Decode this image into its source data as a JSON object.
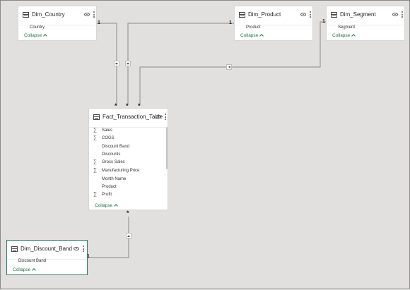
{
  "tables": {
    "dim_country": {
      "title": "Dim_Country",
      "fields": [
        "Country"
      ],
      "collapse": "Collapse"
    },
    "dim_product": {
      "title": "Dim_Product",
      "fields": [
        "Product"
      ],
      "collapse": "Collapse"
    },
    "dim_segment": {
      "title": "Dim_Segment",
      "fields": [
        "Segment"
      ],
      "collapse": "Collapse"
    },
    "fact": {
      "title": "Fact_Transaction_Table",
      "fields": [
        {
          "name": "Sales",
          "sigma": "∑"
        },
        {
          "name": "COGS",
          "sigma": "∑"
        },
        {
          "name": "Discount Band",
          "sigma": ""
        },
        {
          "name": "Discounts",
          "sigma": ""
        },
        {
          "name": "Gross Sales",
          "sigma": "∑"
        },
        {
          "name": "Manufacturing Price",
          "sigma": "∑"
        },
        {
          "name": "Month Name",
          "sigma": ""
        },
        {
          "name": "Product",
          "sigma": ""
        },
        {
          "name": "Profit",
          "sigma": "∑"
        }
      ],
      "collapse": "Collapse"
    },
    "dim_discount_band": {
      "title": "Dim_Discount_Band",
      "fields": [
        "Discount Band"
      ],
      "collapse": "Collapse"
    }
  },
  "cardinality": {
    "one": "1",
    "many": "*"
  },
  "icons": {
    "table": "table-icon",
    "visibility": "eye-icon",
    "more": "more-options-icon",
    "filter_direction": "triangle-icon"
  },
  "colors": {
    "canvas": "#e2e0de",
    "accent": "#217346",
    "selected_border": "#2e7d6e"
  }
}
